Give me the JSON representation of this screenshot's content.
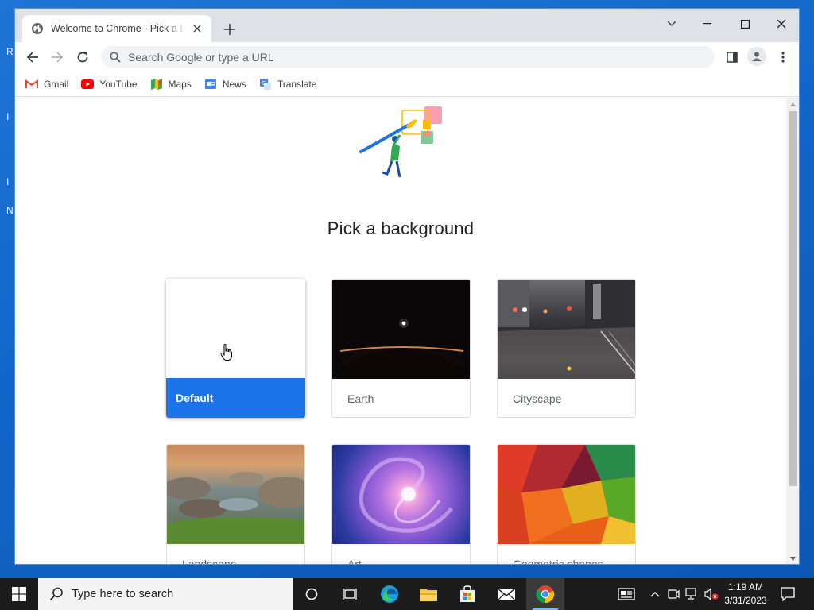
{
  "desktop": {
    "fragments": [
      "R",
      "I",
      "I",
      "N"
    ]
  },
  "browser": {
    "tab": {
      "title": "Welcome to Chrome - Pick a background"
    },
    "omnibox": {
      "placeholder": "Search Google or type a URL"
    },
    "bookmarks": [
      {
        "label": "Gmail",
        "icon": "gmail-icon"
      },
      {
        "label": "YouTube",
        "icon": "youtube-icon"
      },
      {
        "label": "Maps",
        "icon": "maps-icon"
      },
      {
        "label": "News",
        "icon": "news-icon"
      },
      {
        "label": "Translate",
        "icon": "translate-icon"
      }
    ]
  },
  "page": {
    "title": "Pick a background",
    "backgrounds": [
      {
        "label": "Default",
        "selected": true
      },
      {
        "label": "Earth"
      },
      {
        "label": "Cityscape"
      },
      {
        "label": "Landscape"
      },
      {
        "label": "Art"
      },
      {
        "label": "Geometric shapes"
      }
    ]
  },
  "taskbar": {
    "search_placeholder": "Type here to search",
    "clock": {
      "time": "1:19 AM",
      "date": "3/31/2023"
    }
  },
  "colors": {
    "accent": "#1a73e8",
    "taskbar": "#1c1c1c",
    "desktop": "#1266c9"
  }
}
